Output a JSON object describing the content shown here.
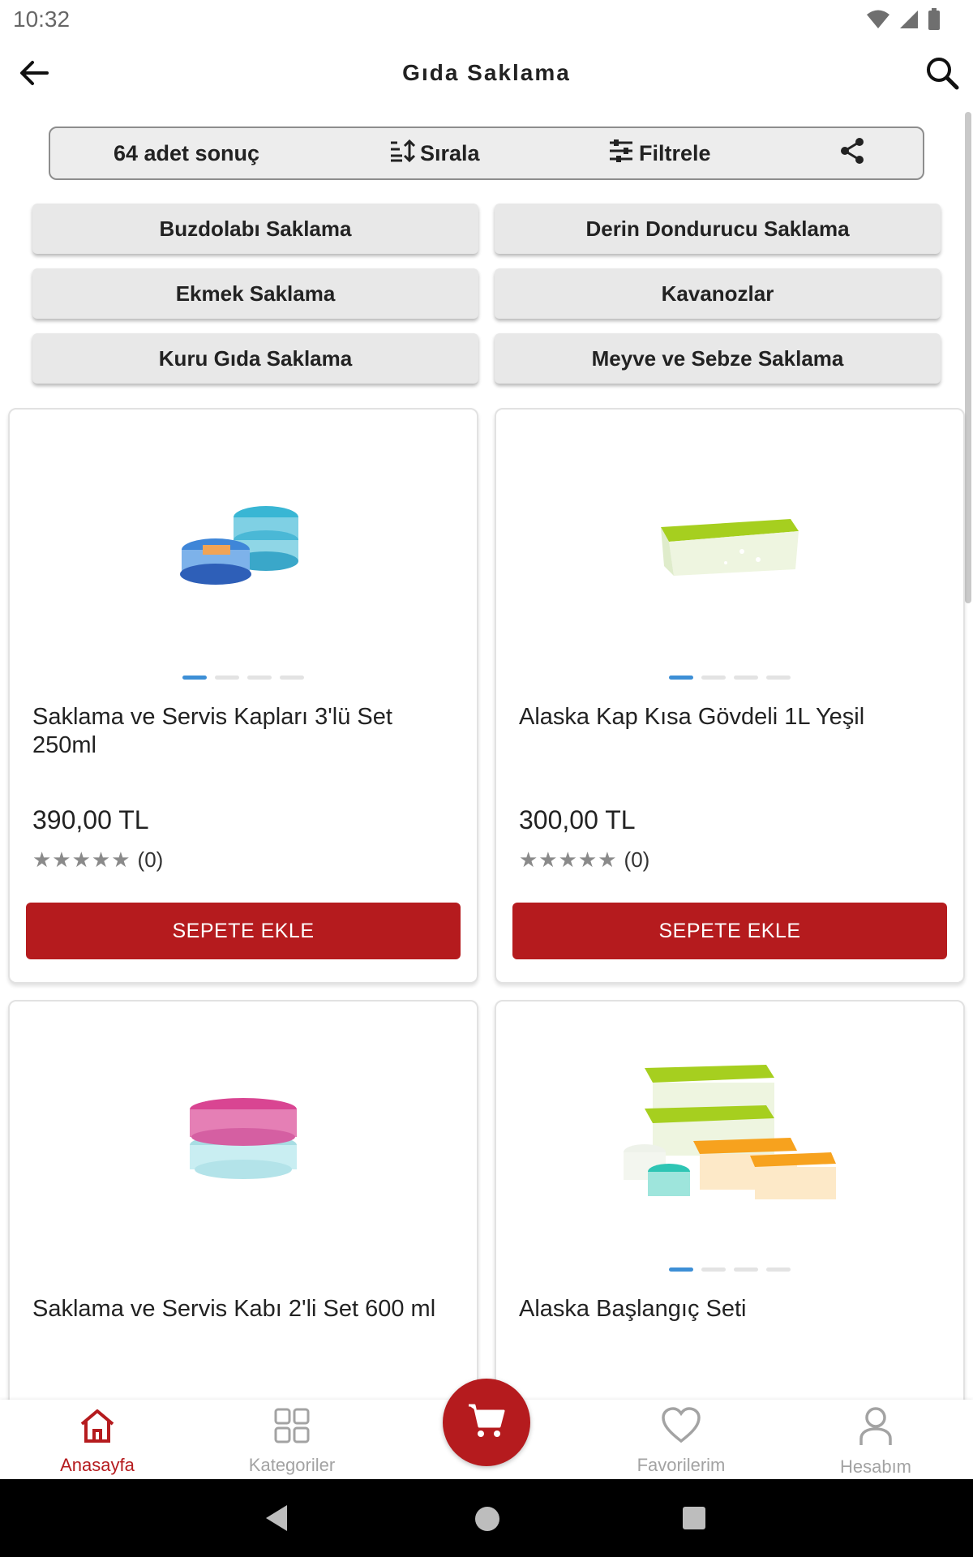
{
  "status_bar": {
    "time": "10:32"
  },
  "app_bar": {
    "title": "Gıda Saklama"
  },
  "toolbar": {
    "result_count": "64 adet sonuç",
    "sort_label": "Sırala",
    "filter_label": "Filtrele"
  },
  "categories": [
    {
      "label": "Buzdolabı Saklama"
    },
    {
      "label": "Derin Dondurucu Saklama"
    },
    {
      "label": "Ekmek Saklama"
    },
    {
      "label": "Kavanozlar"
    },
    {
      "label": "Kuru Gıda Saklama"
    },
    {
      "label": "Meyve ve Sebze Saklama"
    }
  ],
  "products": [
    {
      "name": "Saklama ve Servis Kapları 3'lü Set 250ml",
      "price": "390,00 TL",
      "stars": "★★★★★",
      "rating_count": "(0)",
      "button": "SEPETE EKLE",
      "image_dots": 4,
      "active_dot": 1
    },
    {
      "name": "Alaska Kap Kısa Gövdeli 1L Yeşil",
      "price": "300,00 TL",
      "stars": "★★★★★",
      "rating_count": "(0)",
      "button": "SEPETE EKLE",
      "image_dots": 4,
      "active_dot": 1
    },
    {
      "name": "Saklama ve Servis Kabı 2'li Set 600 ml"
    },
    {
      "name": "Alaska Başlangıç Seti",
      "image_dots": 4,
      "active_dot": 1
    }
  ],
  "bottom_nav": [
    {
      "label": "Anasayfa",
      "icon": "home-icon",
      "active": true
    },
    {
      "label": "Kategoriler",
      "icon": "grid-icon",
      "active": false
    },
    {
      "label": "",
      "icon": "cart-icon",
      "active": false
    },
    {
      "label": "Favorilerim",
      "icon": "heart-icon",
      "active": false
    },
    {
      "label": "Hesabım",
      "icon": "person-icon",
      "active": false
    }
  ],
  "colors": {
    "brand_red": "#b51b1e",
    "dot_active": "#3d8fd6",
    "inactive_nav": "#a3a3a3"
  }
}
